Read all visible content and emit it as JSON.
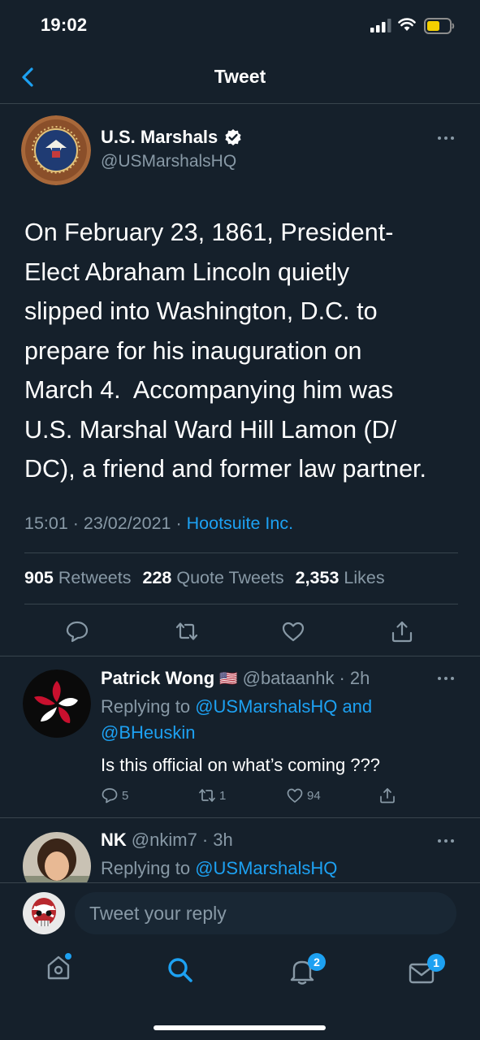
{
  "status_bar": {
    "time": "19:02"
  },
  "nav": {
    "title": "Tweet"
  },
  "tweet": {
    "author_name": "U.S. Marshals",
    "author_handle": "@USMarshalsHQ",
    "text_lines": [
      "On February 23, 1861, President-",
      "Elect Abraham Lincoln quietly",
      "slipped into Washington, D.C. to",
      "prepare for his inauguration on",
      "March 4.  Accompanying him was",
      "U.S. Marshal Ward Hill Lamon (D/",
      "DC), a friend and former law partner."
    ],
    "time": "15:01 · 23/02/2021 · ",
    "source": "Hootsuite Inc.",
    "stats": {
      "retweets": "905",
      "retweets_label": "Retweets",
      "quotes": "228",
      "quotes_label": "Quote Tweets",
      "likes": "2,353",
      "likes_label": "Likes"
    }
  },
  "replies": [
    {
      "name": "Patrick Wong",
      "flag": "🇺🇸",
      "handle": "@bataanhk",
      "age": "· 2h",
      "replying_prefix": "Replying to ",
      "replying_to_line1": "@USMarshalsHQ and",
      "replying_to_line2": "@BHeuskin",
      "text": "Is this official on what’s coming ???",
      "reply_count": "5",
      "retweet_count": "1",
      "like_count": "94"
    },
    {
      "name": "NK",
      "handle": "@nkim7",
      "age": "· 3h",
      "replying_prefix": "Replying to ",
      "replying_to_line1": "@USMarshalsHQ"
    }
  ],
  "compose": {
    "placeholder": "Tweet your reply"
  },
  "tab_bar": {
    "notifications_badge": "2",
    "messages_badge": "1"
  },
  "colors": {
    "background": "#15202b",
    "accent": "#1da1f2",
    "muted": "#8899a6",
    "divider": "#38444d"
  }
}
